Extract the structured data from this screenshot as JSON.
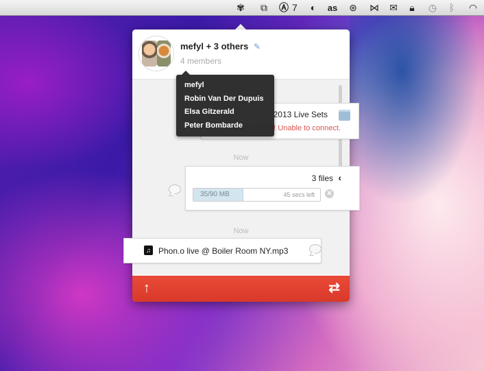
{
  "menubar": {
    "adobe_count": "7"
  },
  "popover": {
    "title": "mefyl + 3 others",
    "members_count": "4 members",
    "members_tooltip": [
      "mefyl",
      "Robin Van Der Dupuis",
      "Elsa Gitzerald",
      "Peter Bombarde"
    ],
    "folder_transfer": {
      "name": "2013 Live Sets",
      "error": "Transfer failed! Unable to connect."
    },
    "timestamp_1": "Now",
    "files_transfer": {
      "files_count": "3 files",
      "progress_text": "35/90 MB",
      "progress_value": 0.389,
      "time_left": "45 secs left"
    },
    "timestamp_2": "Now",
    "file_transfer": {
      "name": "Phon.o live @ Boiler Room NY.mp3"
    }
  },
  "colors": {
    "footer": "#e03f2f",
    "error_text": "#d9534f",
    "progress_fill": "#d3e6f0"
  }
}
